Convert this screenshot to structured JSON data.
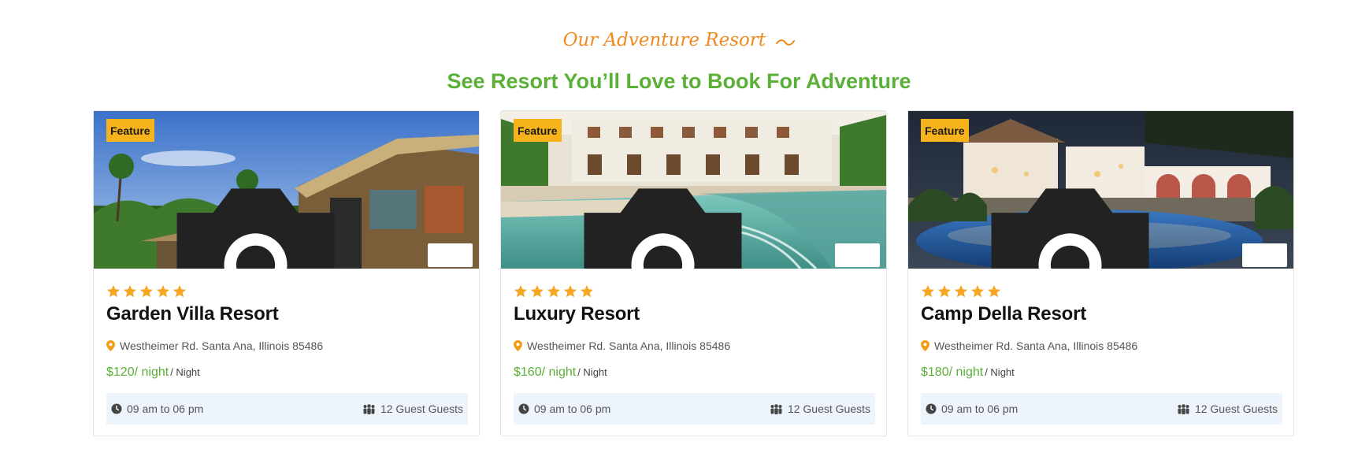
{
  "section": {
    "subtitle": "Our Adventure Resort",
    "title": "See Resort You’ll Love to Book For Adventure"
  },
  "colors": {
    "accent_orange": "#ee8a1f",
    "accent_green": "#5bb038",
    "badge_yellow": "#f6b31c",
    "star_color": "#f5a623"
  },
  "cards": [
    {
      "badge": "Feature",
      "rating": 5,
      "name": "Garden Villa Resort",
      "address": "Westheimer Rd. Santa Ana, Illinois 85486",
      "price": "$120/ night",
      "price_unit": "/ Night",
      "hours": "09 am to 06 pm",
      "guests": "12 Guest Guests"
    },
    {
      "badge": "Feature",
      "rating": 5,
      "name": "Luxury Resort",
      "address": "Westheimer Rd. Santa Ana, Illinois 85486",
      "price": "$160/ night",
      "price_unit": "/ Night",
      "hours": "09 am to 06 pm",
      "guests": "12 Guest Guests"
    },
    {
      "badge": "Feature",
      "rating": 5,
      "name": "Camp Della Resort",
      "address": "Westheimer Rd. Santa Ana, Illinois 85486",
      "price": "$180/ night",
      "price_unit": "/ Night",
      "hours": "09 am to 06 pm",
      "guests": "12 Guest Guests"
    }
  ],
  "icons": {
    "camera": "camera-icon",
    "video": "video-icon",
    "location": "location-pin-icon",
    "clock": "clock-icon",
    "guests": "users-icon",
    "star": "star-icon"
  }
}
